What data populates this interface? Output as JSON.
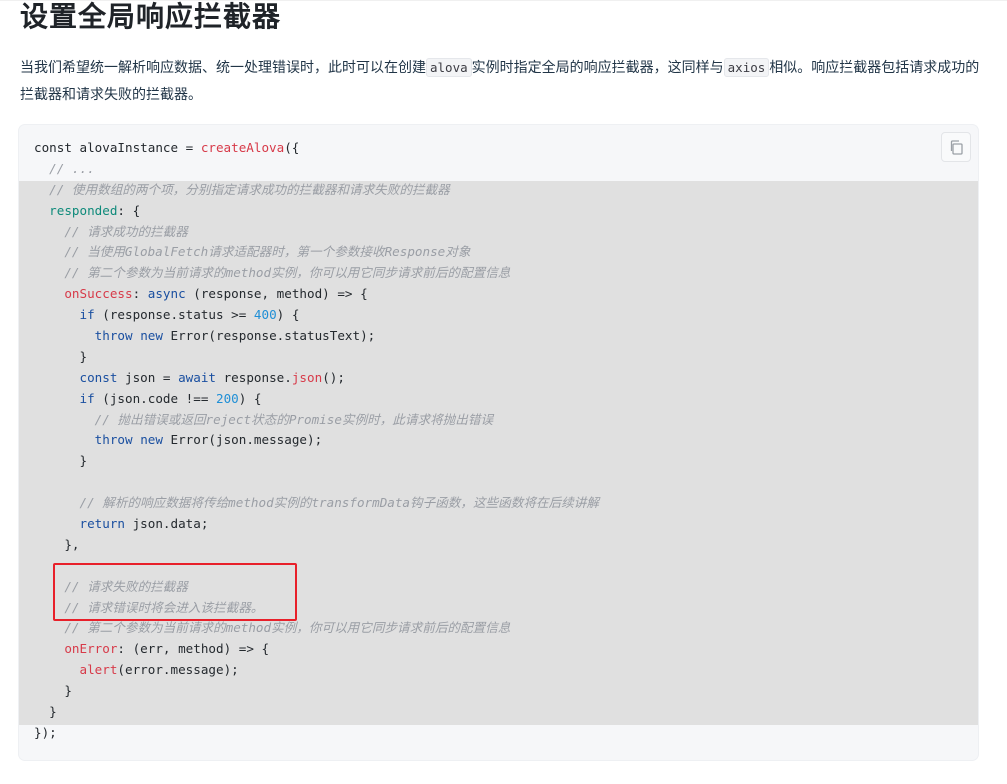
{
  "heading": "设置全局响应拦截器",
  "intro": {
    "part1": "当我们希望统一解析响应数据、统一处理错误时，此时可以在创建",
    "code1": "alova",
    "part2": "实例时指定全局的响应拦截器，这同样与",
    "code2": "axios",
    "part3": "相似。响应拦截器包括请求成功的拦截器和请求失败的拦截器。"
  },
  "code": {
    "copy_icon": "copy-icon",
    "lines": [
      [
        [
          "const alovaInstance = ",
          "plain"
        ],
        [
          "createAlova",
          "func"
        ],
        [
          "({",
          "plain"
        ]
      ],
      [
        [
          "  // ...",
          "comment"
        ]
      ],
      [
        [
          "  // 使用数组的两个项，分别指定请求成功的拦截器和请求失败的拦截器",
          "comment"
        ]
      ],
      [
        [
          "  ",
          "plain"
        ],
        [
          "responded",
          "prop"
        ],
        [
          ": {",
          "plain"
        ]
      ],
      [
        [
          "    // 请求成功的拦截器",
          "comment"
        ]
      ],
      [
        [
          "    // 当使用GlobalFetch请求适配器时，第一个参数接收Response对象",
          "comment"
        ]
      ],
      [
        [
          "    // 第二个参数为当前请求的method实例，你可以用它同步请求前后的配置信息",
          "comment"
        ]
      ],
      [
        [
          "    ",
          "plain"
        ],
        [
          "onSuccess",
          "func"
        ],
        [
          ": ",
          "plain"
        ],
        [
          "async",
          "keyword"
        ],
        [
          " (response, method) => {",
          "plain"
        ]
      ],
      [
        [
          "      ",
          "plain"
        ],
        [
          "if",
          "keyword"
        ],
        [
          " (response.status >= ",
          "plain"
        ],
        [
          "400",
          "number"
        ],
        [
          ") {",
          "plain"
        ]
      ],
      [
        [
          "        ",
          "plain"
        ],
        [
          "throw",
          "keyword"
        ],
        [
          " ",
          "plain"
        ],
        [
          "new",
          "keyword"
        ],
        [
          " Error(response.statusText);",
          "plain"
        ]
      ],
      [
        [
          "      }",
          "plain"
        ]
      ],
      [
        [
          "      ",
          "plain"
        ],
        [
          "const",
          "keyword"
        ],
        [
          " json = ",
          "plain"
        ],
        [
          "await",
          "keyword"
        ],
        [
          " response.",
          "plain"
        ],
        [
          "json",
          "func"
        ],
        [
          "();",
          "plain"
        ]
      ],
      [
        [
          "      ",
          "plain"
        ],
        [
          "if",
          "keyword"
        ],
        [
          " (json.code !== ",
          "plain"
        ],
        [
          "200",
          "number"
        ],
        [
          ") {",
          "plain"
        ]
      ],
      [
        [
          "        // 抛出错误或返回reject状态的Promise实例时，此请求将抛出错误",
          "comment"
        ]
      ],
      [
        [
          "        ",
          "plain"
        ],
        [
          "throw",
          "keyword"
        ],
        [
          " ",
          "plain"
        ],
        [
          "new",
          "keyword"
        ],
        [
          " Error(json.message);",
          "plain"
        ]
      ],
      [
        [
          "      }",
          "plain"
        ]
      ],
      [
        [
          "",
          "plain"
        ]
      ],
      [
        [
          "      // 解析的响应数据将传给method实例的transformData钩子函数，这些函数将在后续讲解",
          "comment"
        ]
      ],
      [
        [
          "      ",
          "plain"
        ],
        [
          "return",
          "keyword"
        ],
        [
          " json.data;",
          "plain"
        ]
      ],
      [
        [
          "    },",
          "plain"
        ]
      ],
      [
        [
          "",
          "plain"
        ]
      ],
      [
        [
          "    // 请求失败的拦截器",
          "comment"
        ]
      ],
      [
        [
          "    // 请求错误时将会进入该拦截器。",
          "comment"
        ]
      ],
      [
        [
          "    // 第二个参数为当前请求的method实例，你可以用它同步请求前后的配置信息",
          "comment"
        ]
      ],
      [
        [
          "    ",
          "plain"
        ],
        [
          "onError",
          "func"
        ],
        [
          ": (err, method) => {",
          "plain"
        ]
      ],
      [
        [
          "      ",
          "plain"
        ],
        [
          "alert",
          "func"
        ],
        [
          "(error.message);",
          "plain"
        ]
      ],
      [
        [
          "    }",
          "plain"
        ]
      ],
      [
        [
          "  }",
          "plain"
        ]
      ],
      [
        [
          "});",
          "plain"
        ]
      ]
    ]
  },
  "colors": {
    "keyword": "#1a4fa0",
    "function": "#d73a49",
    "property": "#0e8a7a",
    "number": "#1f8fd6",
    "comment": "#9a9ea5",
    "annotation": "#e8202a",
    "highlight": "#e0e0e0"
  }
}
